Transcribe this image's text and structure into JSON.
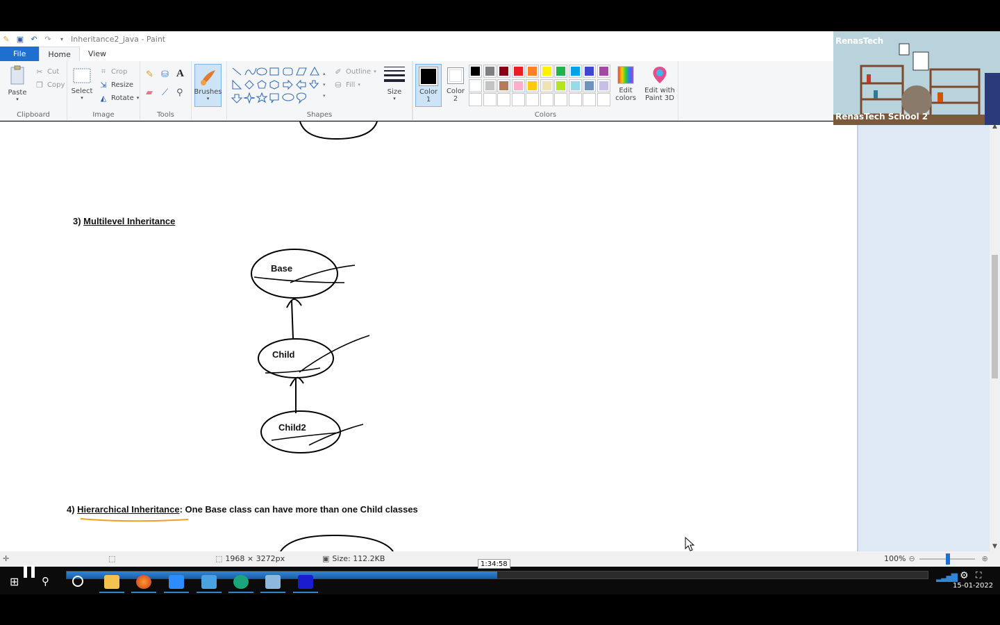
{
  "window": {
    "title": "Inheritance2_java - Paint"
  },
  "tabs": [
    {
      "label": "File"
    },
    {
      "label": "Home"
    },
    {
      "label": "View"
    }
  ],
  "ribbon": {
    "clipboard": {
      "label": "Clipboard",
      "paste": "Paste",
      "cut": "Cut",
      "copy": "Copy"
    },
    "image": {
      "label": "Image",
      "select": "Select",
      "crop": "Crop",
      "resize": "Resize",
      "rotate": "Rotate"
    },
    "tools": {
      "label": "Tools"
    },
    "brushes": {
      "label": "Brushes"
    },
    "shapes": {
      "label": "Shapes",
      "outline": "Outline",
      "fill": "Fill"
    },
    "size": {
      "label": "Size"
    },
    "color1": {
      "label": "Color",
      "num": "1"
    },
    "color2": {
      "label": "Color",
      "num": "2"
    },
    "colors": {
      "label": "Colors"
    },
    "edit_colors": {
      "line1": "Edit",
      "line2": "colors"
    },
    "paint3d": {
      "line1": "Edit with",
      "line2": "Paint 3D"
    },
    "palette_row1": [
      "#000000",
      "#7f7f7f",
      "#880015",
      "#ed1c24",
      "#ff7f27",
      "#fff200",
      "#22b14c",
      "#00a2e8",
      "#3f48cc",
      "#a349a4"
    ],
    "palette_row2": [
      "#ffffff",
      "#c3c3c3",
      "#b97a57",
      "#ffaec9",
      "#ffc90e",
      "#efe4b0",
      "#b5e61d",
      "#99d9ea",
      "#7092be",
      "#c8bfe7"
    ]
  },
  "canvas": {
    "section3": {
      "prefix": "3) ",
      "title": "Multilevel Inheritance"
    },
    "section4": {
      "prefix": "4) ",
      "title": "Hierarchical Inheritance",
      "rest": ": One Base class can have more than one Child classes"
    },
    "nodes": {
      "base": "Base",
      "child": "Child",
      "child2": "Child2"
    }
  },
  "video_overlay": {
    "brand": "RenasTech",
    "participant": "RenasTech School 2"
  },
  "statusbar": {
    "dimensions": "1968 × 3272px",
    "size": "Size: 112.2KB",
    "zoom": "100%"
  },
  "player": {
    "timestamp": "1:34:58",
    "progress": 0.5,
    "date": "15-01-2022"
  }
}
